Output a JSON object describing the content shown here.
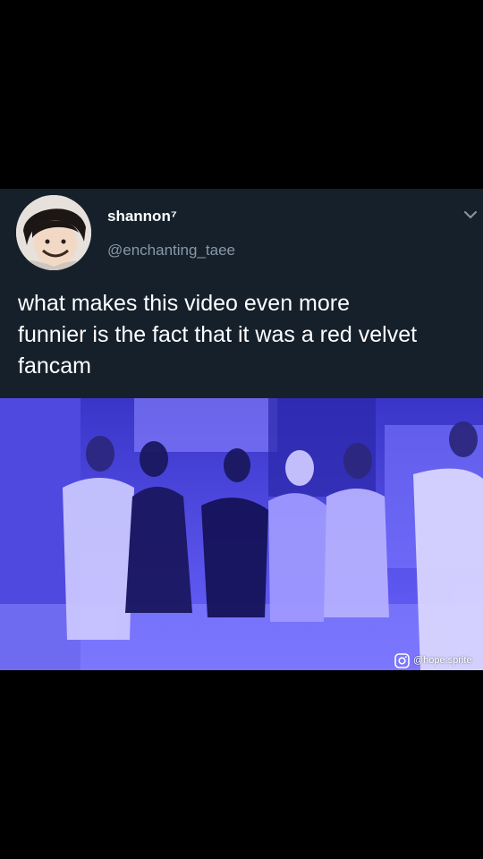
{
  "tweet": {
    "display_name": "shannon⁷",
    "handle": "@enchanting_taee",
    "text": "what makes this video even more\nfunnier is the fact that it was a red velvet\nfancam",
    "icons": {
      "avatar": "profile-avatar",
      "menu": "chevron-down-icon"
    }
  },
  "media": {
    "watermark_handle": "@hope.sprite",
    "watermark_icon": "instagram-icon",
    "tint": "#5a52e8"
  },
  "colors": {
    "background": "#000000",
    "tweet_bg": "#15202b",
    "text": "#ffffff",
    "muted": "#8899a6"
  }
}
